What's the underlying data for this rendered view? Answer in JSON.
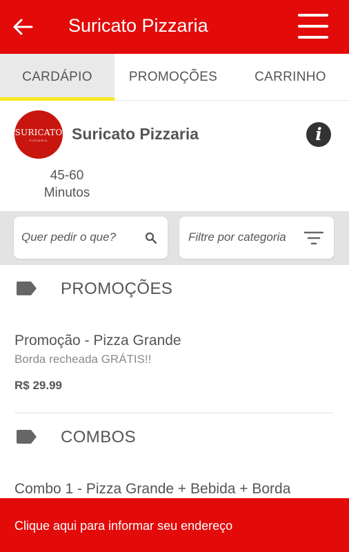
{
  "appbar": {
    "title": "Suricato Pizzaria",
    "background": "#e30a0a"
  },
  "tabs": [
    {
      "label": "CARDÁPIO",
      "active": true
    },
    {
      "label": "PROMOÇÕES",
      "active": false
    },
    {
      "label": "CARRINHO",
      "active": false
    }
  ],
  "tab_indicator_color": "#f7e81c",
  "shop": {
    "name": "Suricato Pizzaria",
    "logo_text": "SURICATO",
    "logo_subtext": "PIZZARIA",
    "time_range": "45-60",
    "time_unit": "Minutos"
  },
  "filters": {
    "search_placeholder": "Quer pedir o que?",
    "category_placeholder": "Filtre por categoria"
  },
  "sections": [
    {
      "title": "PROMOÇÕES",
      "items": [
        {
          "name": "Promoção - Pizza Grande",
          "description": "Borda recheada GRÁTIS!!",
          "price": "R$ 29.99"
        }
      ]
    },
    {
      "title": "COMBOS",
      "items": [
        {
          "name": "Combo 1 - Pizza Grande + Bebida + Borda"
        }
      ]
    }
  ],
  "footer": {
    "text": "Clique aqui para informar seu endereço"
  }
}
